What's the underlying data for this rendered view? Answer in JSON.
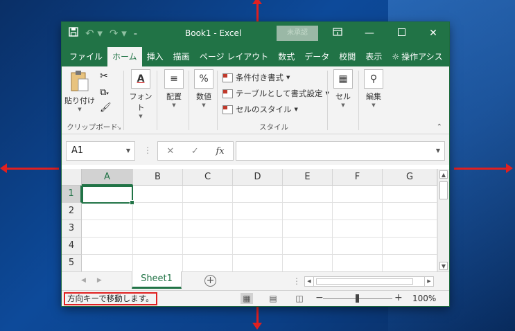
{
  "window": {
    "title": "Book1  -  Excel",
    "signin_label": "未承認"
  },
  "quick_access": {
    "save_icon": "save-icon",
    "undo_icon": "undo-icon",
    "redo_icon": "redo-icon",
    "customize_icon": "customize-icon"
  },
  "title_controls": {
    "ribbon_options_icon": "ribbon-display-icon",
    "minimize_icon": "minimize-icon",
    "maximize_icon": "maximize-icon",
    "close_icon": "close-icon"
  },
  "tabs": [
    {
      "label": "ファイル"
    },
    {
      "label": "ホーム"
    },
    {
      "label": "挿入"
    },
    {
      "label": "描画"
    },
    {
      "label": "ページ レイアウト"
    },
    {
      "label": "数式"
    },
    {
      "label": "データ"
    },
    {
      "label": "校閲"
    },
    {
      "label": "表示"
    },
    {
      "label": "操作アシス"
    }
  ],
  "ribbon": {
    "clipboard": {
      "paste": "貼り付け",
      "group": "クリップボード"
    },
    "font": {
      "label": "フォント"
    },
    "alignment": {
      "label": "配置"
    },
    "number": {
      "label": "数値"
    },
    "styles": {
      "conditional": "条件付き書式",
      "table": "テーブルとして書式設定",
      "cell_styles": "セルのスタイル",
      "group": "スタイル"
    },
    "cells": {
      "label": "セル"
    },
    "editing": {
      "label": "編集"
    }
  },
  "formula_bar": {
    "name_box": "A1",
    "formula": "",
    "fx": "fx"
  },
  "grid": {
    "columns": [
      "A",
      "B",
      "C",
      "D",
      "E",
      "F",
      "G"
    ],
    "rows": [
      "1",
      "2",
      "3",
      "4",
      "5"
    ],
    "active_cell": "A1"
  },
  "sheets": [
    {
      "name": "Sheet1"
    }
  ],
  "status": {
    "message": "方向キーで移動します。",
    "zoom": "100%"
  },
  "colors": {
    "excel_green": "#217346",
    "annotation_red": "#e02020"
  }
}
